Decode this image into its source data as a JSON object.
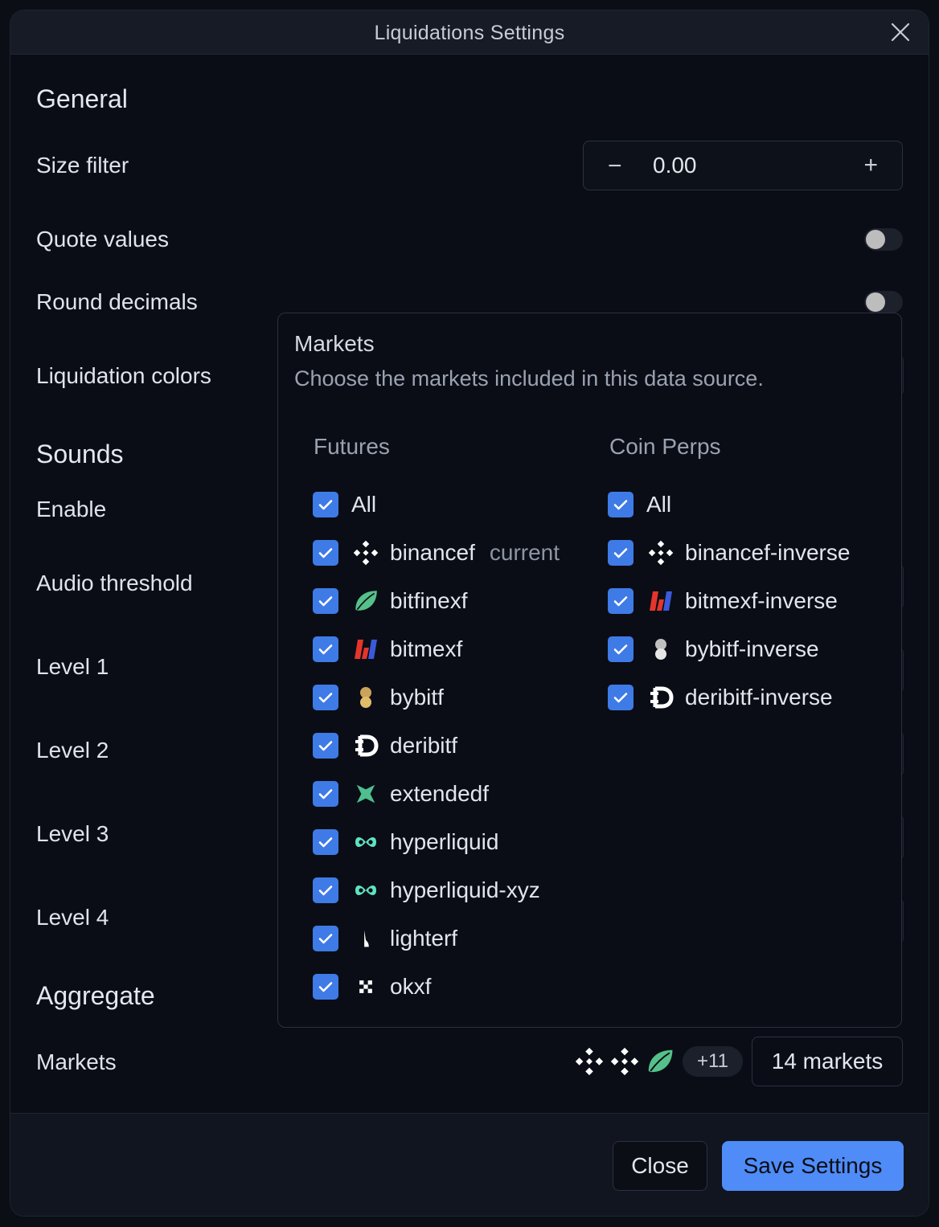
{
  "dialog": {
    "title": "Liquidations Settings"
  },
  "general": {
    "title": "General",
    "size_filter": {
      "label": "Size filter",
      "value": "0.00",
      "minus": "−",
      "plus": "+"
    },
    "quote_values": {
      "label": "Quote values",
      "enabled": false
    },
    "round_decimals": {
      "label": "Round decimals",
      "enabled": false
    },
    "liquidation_colors": {
      "label": "Liquidation colors"
    }
  },
  "sounds": {
    "title": "Sounds",
    "enable": "Enable",
    "audio_threshold": "Audio threshold",
    "levels": [
      "Level 1",
      "Level 2",
      "Level 3",
      "Level 4"
    ]
  },
  "aggregate": {
    "title": "Aggregate",
    "markets_label": "Markets",
    "more_badge": "+11",
    "markets_button": "14 markets"
  },
  "markets_popover": {
    "title": "Markets",
    "subtitle": "Choose the markets included in this data source.",
    "futures": {
      "header": "Futures",
      "all": "All",
      "items": [
        {
          "name": "binancef",
          "tag": "current",
          "icon": "binance-icon"
        },
        {
          "name": "bitfinexf",
          "icon": "bitfinex-leaf-icon"
        },
        {
          "name": "bitmexf",
          "icon": "bitmex-icon"
        },
        {
          "name": "bybitf",
          "icon": "bybit-icon"
        },
        {
          "name": "deribitf",
          "icon": "deribit-icon"
        },
        {
          "name": "extendedf",
          "icon": "extended-icon"
        },
        {
          "name": "hyperliquid",
          "icon": "hyperliquid-icon"
        },
        {
          "name": "hyperliquid-xyz",
          "icon": "hyperliquid-icon"
        },
        {
          "name": "lighterf",
          "icon": "lighter-icon"
        },
        {
          "name": "okxf",
          "icon": "okx-icon"
        }
      ]
    },
    "coin_perps": {
      "header": "Coin Perps",
      "all": "All",
      "items": [
        {
          "name": "binancef-inverse",
          "icon": "binance-icon"
        },
        {
          "name": "bitmexf-inverse",
          "icon": "bitmex-icon"
        },
        {
          "name": "bybitf-inverse",
          "icon": "bybit-icon"
        },
        {
          "name": "deribitf-inverse",
          "icon": "deribit-icon"
        }
      ]
    }
  },
  "footer": {
    "close": "Close",
    "save": "Save Settings"
  },
  "colors": {
    "accent": "#4f8cf7",
    "checkbox": "#3f7be6",
    "background": "#0a0d16"
  }
}
